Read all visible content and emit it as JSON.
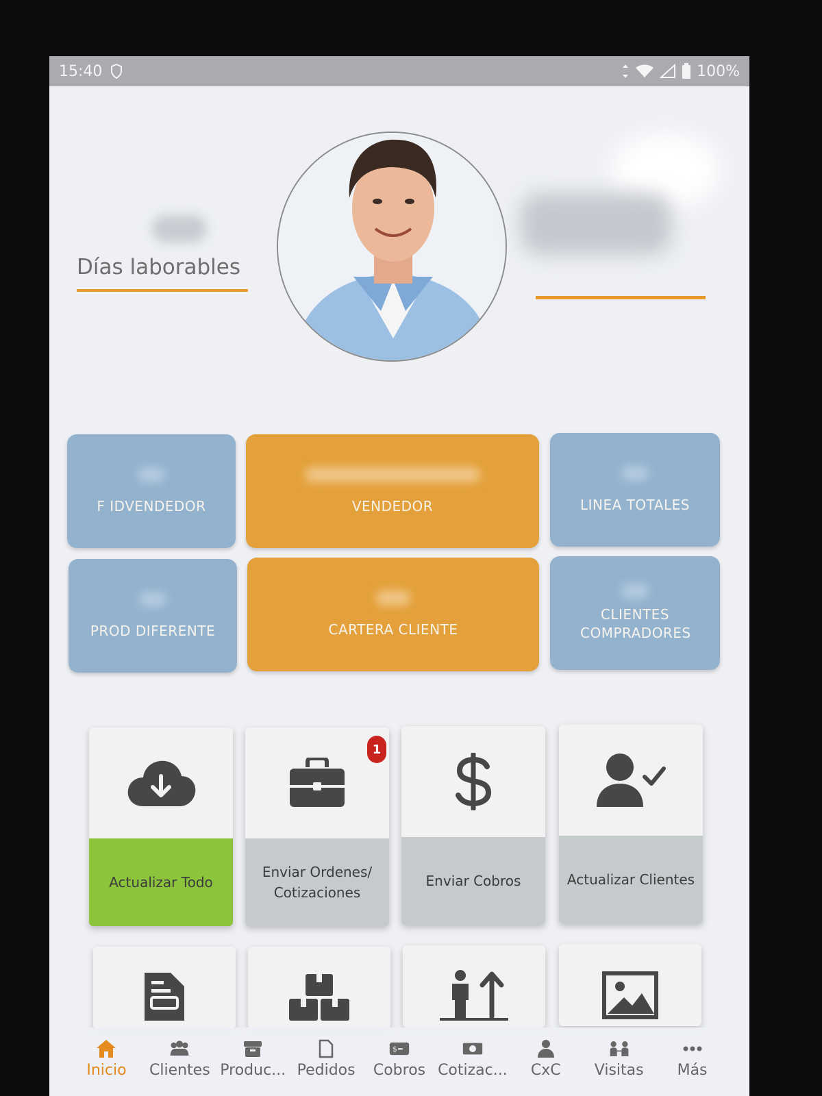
{
  "status_bar": {
    "time": "15:40",
    "battery": "100%"
  },
  "profile": {
    "days_label": "Días laborables"
  },
  "stat_tiles": [
    {
      "label": "F IDVENDEDOR",
      "color": "#93b2ce"
    },
    {
      "label": "VENDEDOR",
      "color": "#e4a03a"
    },
    {
      "label": "LINEA TOTALES",
      "color": "#93b2ce"
    },
    {
      "label": "PROD DIFERENTE",
      "color": "#93b2ce"
    },
    {
      "label": "CARTERA CLIENTE",
      "color": "#e4a03a"
    },
    {
      "label": "CLIENTES COMPRADORES",
      "color": "#93b2ce"
    }
  ],
  "actions": [
    {
      "label": "Actualizar Todo",
      "icon": "cloud-download-icon",
      "highlight_color": "#8cc43c"
    },
    {
      "label": "Enviar Ordenes/ Cotizaciones",
      "icon": "briefcase-icon",
      "badge": "1"
    },
    {
      "label": "Enviar Cobros",
      "icon": "dollar-icon"
    },
    {
      "label": "Actualizar Clientes",
      "icon": "user-check-icon"
    }
  ],
  "actions_row2": [
    {
      "icon": "document-icon"
    },
    {
      "icon": "boxes-icon"
    },
    {
      "icon": "person-up-icon"
    },
    {
      "icon": "image-icon"
    }
  ],
  "bottom_nav": [
    {
      "label": "Inicio",
      "icon": "home-icon",
      "active": true
    },
    {
      "label": "Clientes",
      "icon": "people-icon"
    },
    {
      "label": "Produc...",
      "icon": "box-icon"
    },
    {
      "label": "Pedidos",
      "icon": "file-icon"
    },
    {
      "label": "Cobros",
      "icon": "money-icon"
    },
    {
      "label": "Cotizac...",
      "icon": "cash-icon"
    },
    {
      "label": "CxC",
      "icon": "person-icon"
    },
    {
      "label": "Visitas",
      "icon": "visit-icon"
    },
    {
      "label": "Más",
      "icon": "more-icon"
    }
  ],
  "colors": {
    "accent_orange": "#e69a2d",
    "tile_blue": "#93b2ce",
    "nav_active": "#e48a1f"
  }
}
